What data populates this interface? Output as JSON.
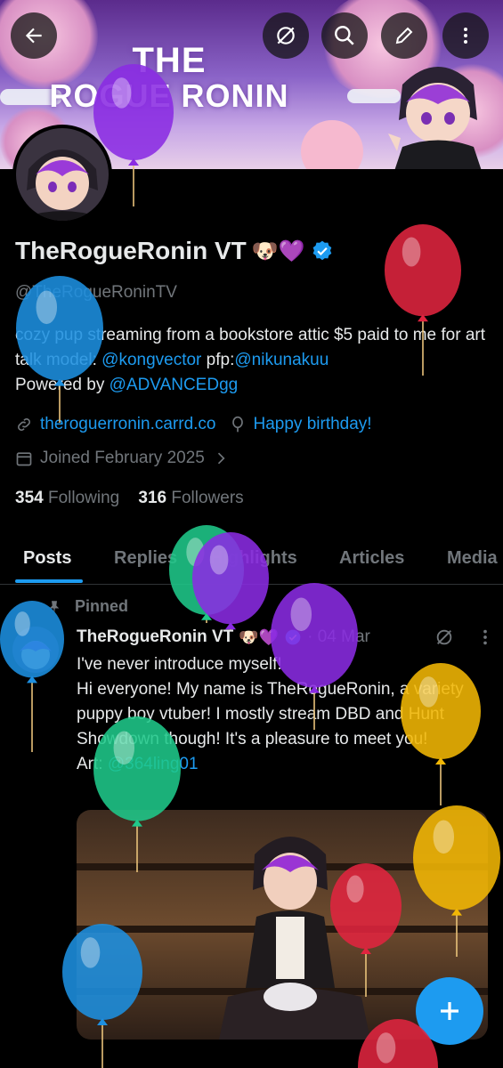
{
  "banner": {
    "title_line1": "THE",
    "title_line2": "ROGUE RONIN"
  },
  "profile": {
    "name": "TheRogueRonin VT",
    "name_emojis": "🐶💜",
    "handle": "@TheRogueRoninTV",
    "bio_part1": "cozy pup streaming from a bookstore attic $5 paid to me for art talk model: ",
    "bio_mention1": "@kongvector",
    "bio_part2": " pfp:",
    "bio_mention2": "@nikunakuu",
    "bio_part3": "Powered by ",
    "bio_mention3": "@ADVANCEDgg",
    "website": "theroguerronin.carrd.co",
    "birthday": "Happy birthday!",
    "joined": "Joined February 2025",
    "following_count": "354",
    "following_label": "Following",
    "followers_count": "316",
    "followers_label": "Followers"
  },
  "tabs": [
    "Posts",
    "Replies",
    "Highlights",
    "Articles",
    "Media"
  ],
  "post": {
    "pinned_label": "Pinned",
    "author": "TheRogueRonin VT",
    "author_emojis": "🐶💜",
    "date": "· 04 Mar",
    "line1": "I've never introduce myself!",
    "line2": "Hi everyone! My name is TheRogueRonin, a variety puppy boy vtuber! I mostly stream DBD and Hunt Showdown though! It's a pleasure to meet you!",
    "art_label": "Art: ",
    "art_mention": "@364ling01"
  },
  "colors": {
    "accent": "#1d9bf0",
    "muted": "#71767b",
    "text": "#e7e9ea",
    "background": "#000000"
  },
  "icons": [
    "back-arrow-icon",
    "grok-icon",
    "search-icon",
    "edit-icon",
    "more-vertical-icon",
    "link-icon",
    "balloon-icon",
    "calendar-icon",
    "chevron-right-icon",
    "pin-icon",
    "verified-icon",
    "plus-icon"
  ]
}
